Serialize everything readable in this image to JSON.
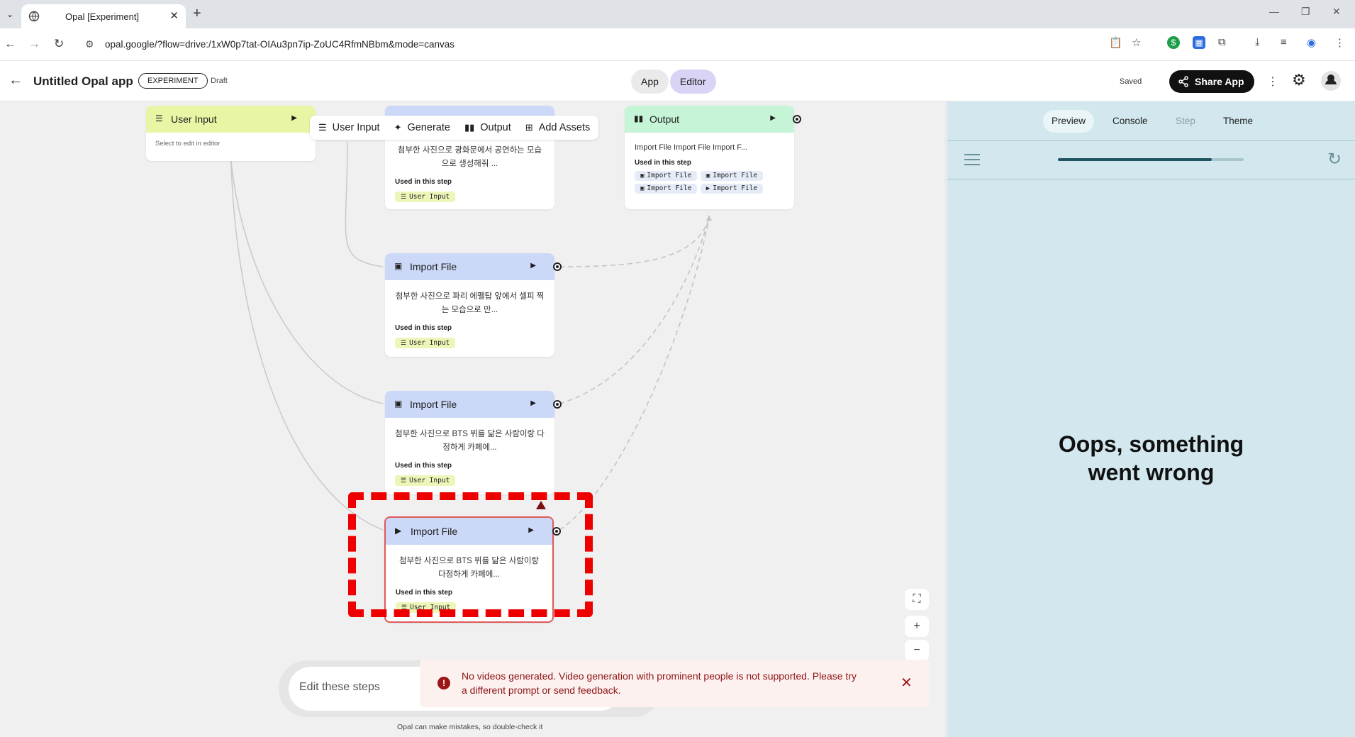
{
  "browser": {
    "tab_title": "Opal [Experiment]",
    "url": "opal.google/?flow=drive:/1xW0p7tat-OIAu3pn7ip-ZoUC4RfmNBbm&mode=canvas"
  },
  "header": {
    "title": "Untitled Opal app",
    "badge": "EXPERIMENT",
    "status": "Draft",
    "mode_tabs": [
      "App",
      "Editor"
    ],
    "active_mode": "Editor",
    "saved": "Saved",
    "share_label": "Share App"
  },
  "toolbar": {
    "items": [
      "User Input",
      "Generate",
      "Output",
      "Add Assets"
    ]
  },
  "nodes": {
    "user_input": {
      "title": "User Input",
      "hint": "Select to edit in editor"
    },
    "top_generate": {
      "desc": "첨부한 사진으로 광화문에서 공연하는 모습으로 생성해줘 ...",
      "used": "Used in this step",
      "chip": "User Input"
    },
    "import1": {
      "title": "Import File",
      "desc": "첨부한 사진으로 파리 에펠탑 앞에서 셀피 찍는 모습으로 만...",
      "used": "Used in this step",
      "chip": "User Input"
    },
    "import2": {
      "title": "Import File",
      "desc": "첨부한 사진으로 BTS 뷔를 닮은 사람이랑 다정하게 카페에...",
      "used": "Used in this step",
      "chip": "User Input"
    },
    "import3": {
      "title": "Import File",
      "desc": "첨부한 사진으로 BTS 뷔를 닮은 사람이랑 다정하게 카페에...",
      "used": "Used in this step",
      "chip": "User Input"
    },
    "output": {
      "title": "Output",
      "desc": "Import File Import File Import F...",
      "used": "Used in this step",
      "chips": [
        "Import File",
        "Import File",
        "Import File",
        "Import File"
      ]
    }
  },
  "editor": {
    "placeholder": "Edit these steps",
    "disclaimer": "Opal can make mistakes, so double-check it"
  },
  "error": {
    "message": "No videos generated. Video generation with prominent people is not supported. Please try a different prompt or send feedback."
  },
  "panel": {
    "tabs": [
      "Preview",
      "Console",
      "Step",
      "Theme"
    ],
    "active_tab": "Preview",
    "progress": 0.83,
    "error_title": "Oops, something went wrong"
  },
  "colors": {
    "accent_editor": "#d9d4f6",
    "user_input_header": "#e8f5a4",
    "import_header": "#cbd8f7",
    "output_header": "#c6f4d6",
    "error_red": "#8c1515",
    "selection": "#ee0000",
    "panel_bg": "#d2e8ee"
  }
}
